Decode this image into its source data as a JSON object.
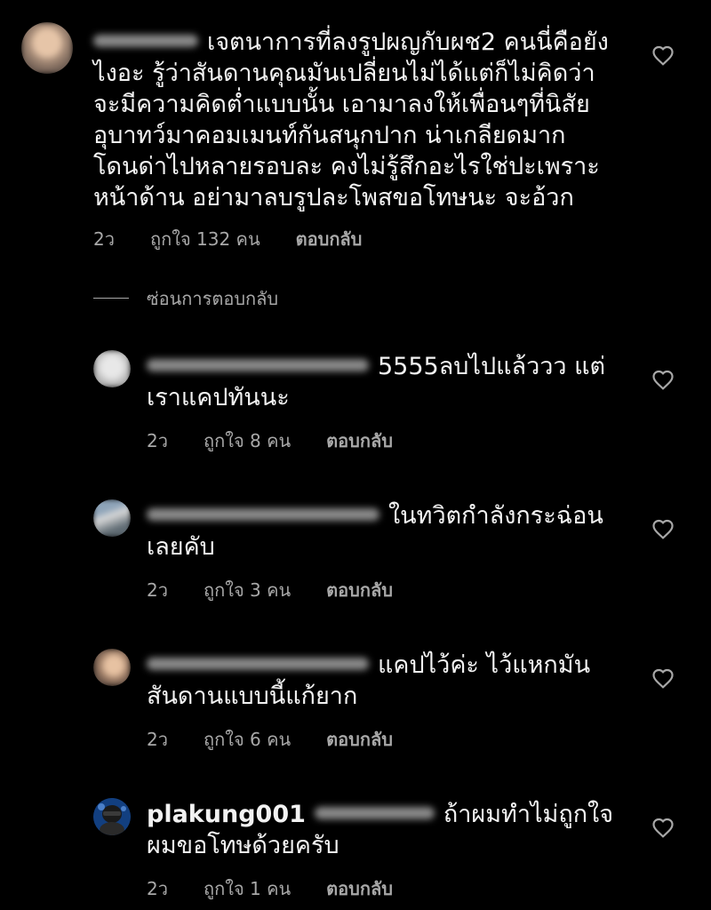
{
  "main_comment": {
    "text": "เจตนาการที่ลงรูปผญกับผช2 คนนี่คือยังไงอะ รู้ว่าสันดานคุณมันเปลี่ยนไม่ได้แต่ก็ไม่คิดว่าจะมีความคิดต่ำแบบนั้น เอามาลงให้เพื่อนๆที่นิสัยอุบาทว์มาคอมเมนท์กันสนุกปาก น่าเกลียดมาก โดนด่าไปหลายรอบละ คงไม่รู้สึกอะไรใช่ปะเพราะหน้าด้าน อย่ามาลบรูปละโพสขอโทษนะ จะอ้วก",
    "time": "2ว",
    "likes": "ถูกใจ 132 คน",
    "reply": "ตอบกลับ"
  },
  "hide_replies_label": "ซ่อนการตอบกลับ",
  "replies": [
    {
      "text": "5555ลบไปแล้ววว แต่เราแคปทันนะ",
      "time": "2ว",
      "likes": "ถูกใจ 8 คน",
      "reply": "ตอบกลับ"
    },
    {
      "text": "ในทวิตกำลังกระฉ่อนเลยคับ",
      "time": "2ว",
      "likes": "ถูกใจ 3 คน",
      "reply": "ตอบกลับ"
    },
    {
      "text": "แคปไว้ค่ะ ไว้แหกมันสันดานแบบนี้แก้ยาก",
      "time": "2ว",
      "likes": "ถูกใจ 6 คน",
      "reply": "ตอบกลับ"
    },
    {
      "username": "plakung001",
      "text": "ถ้าผมทำไม่ถูกใจผมขอโทษด้วยครับ",
      "time": "2ว",
      "likes": "ถูกใจ 1 คน",
      "reply": "ตอบกลับ"
    }
  ],
  "colors": {
    "background": "#000000",
    "text": "#f2f2f2",
    "meta": "#a8a8a8"
  },
  "icons": {
    "like": "heart-outline-icon"
  }
}
